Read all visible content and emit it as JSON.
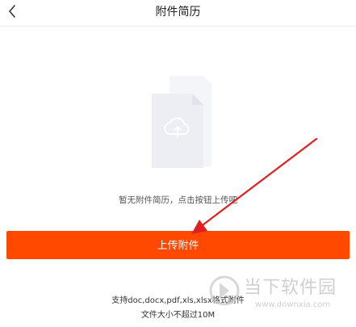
{
  "header": {
    "title": "附件简历",
    "back_icon": "chevron-left-icon"
  },
  "empty_state": {
    "illustration_icon": "cloud-upload-document-icon",
    "message": "暂无附件简历，点击按钮上传吧"
  },
  "upload_button": {
    "label": "上传附件",
    "color": "#ff4800"
  },
  "hints": {
    "formats": "支持doc,docx,pdf,xls,xlsx格式附件",
    "size_limit": "文件大小不超过10M"
  },
  "annotation": {
    "arrow_color": "#e02020"
  },
  "watermark": {
    "name": "当下软件园",
    "url": "www.downxia.com"
  }
}
